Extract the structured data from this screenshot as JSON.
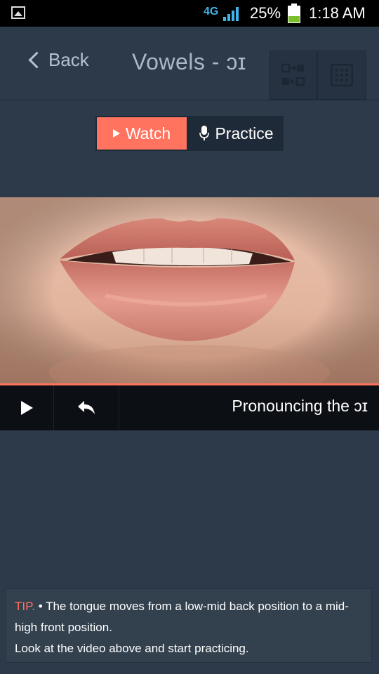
{
  "status_bar": {
    "network": "4G",
    "battery": "25%",
    "time": "1:18 AM"
  },
  "header": {
    "back_label": "Back",
    "title": "Vowels - ɔɪ"
  },
  "mode_tabs": {
    "watch": "Watch",
    "practice": "Practice",
    "selected": "Watch"
  },
  "video": {
    "caption": "Pronouncing the ɔɪ"
  },
  "tip": {
    "label": "TIP.",
    "line1": "• The tongue moves from a low-mid back position to a mid-high front position.",
    "line2": "Look at the video above and start practicing."
  },
  "colors": {
    "accent": "#ff735f",
    "background": "#2d3a4a",
    "text_muted": "#aab7c6"
  }
}
